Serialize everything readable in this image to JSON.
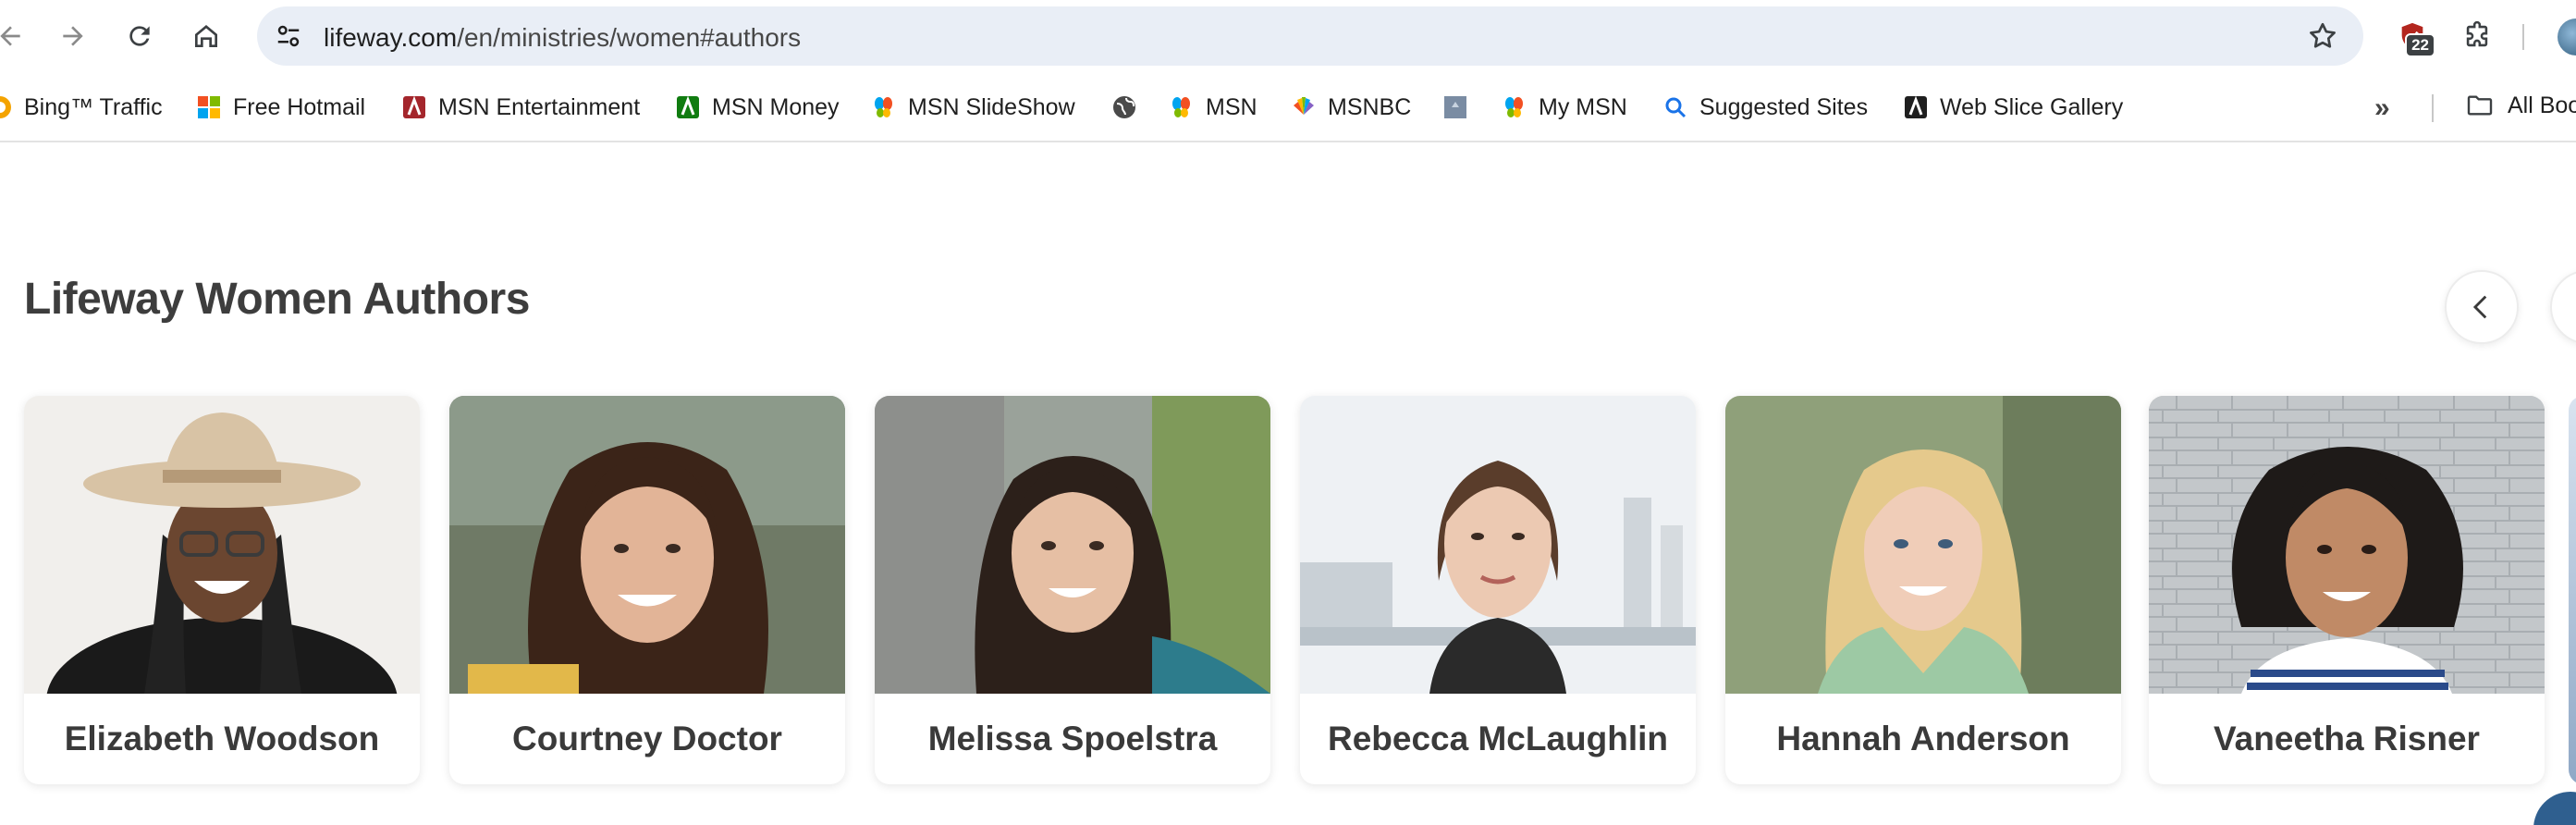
{
  "browser": {
    "url_host": "lifeway.com",
    "url_path": "/en/ministries/women#authors",
    "extension_badge": "22"
  },
  "bookmarks": {
    "items": [
      {
        "label": "Bing™ Traffic",
        "icon": "bing-icon"
      },
      {
        "label": "Free Hotmail",
        "icon": "windows-icon"
      },
      {
        "label": "MSN Entertainment",
        "icon": "msn-icon"
      },
      {
        "label": "MSN Money",
        "icon": "msn-money-icon"
      },
      {
        "label": "MSN SlideShow",
        "icon": "msn-butterfly-icon"
      },
      {
        "label": "",
        "icon": "globe-icon"
      },
      {
        "label": "MSN",
        "icon": "msn-butterfly-icon"
      },
      {
        "label": "MSNBC",
        "icon": "nbc-peacock-icon"
      },
      {
        "label": "",
        "icon": "generic-page-icon"
      },
      {
        "label": "My MSN",
        "icon": "msn-butterfly-icon"
      },
      {
        "label": "Suggested Sites",
        "icon": "search-icon"
      },
      {
        "label": "Web Slice Gallery",
        "icon": "web-slice-icon"
      }
    ],
    "more_label": "»",
    "all_bookmarks_label": "All Boo"
  },
  "section": {
    "title": "Lifeway Women Authors"
  },
  "authors": [
    {
      "name": "Elizabeth Woodson"
    },
    {
      "name": "Courtney Doctor"
    },
    {
      "name": "Melissa Spoelstra"
    },
    {
      "name": "Rebecca McLaughlin"
    },
    {
      "name": "Hannah Anderson"
    },
    {
      "name": "Vaneetha Risner"
    }
  ],
  "colors": {
    "accent": "#2f5f8f",
    "title_text": "#3d3d3d",
    "omnibox_bg": "#e9eef6"
  }
}
